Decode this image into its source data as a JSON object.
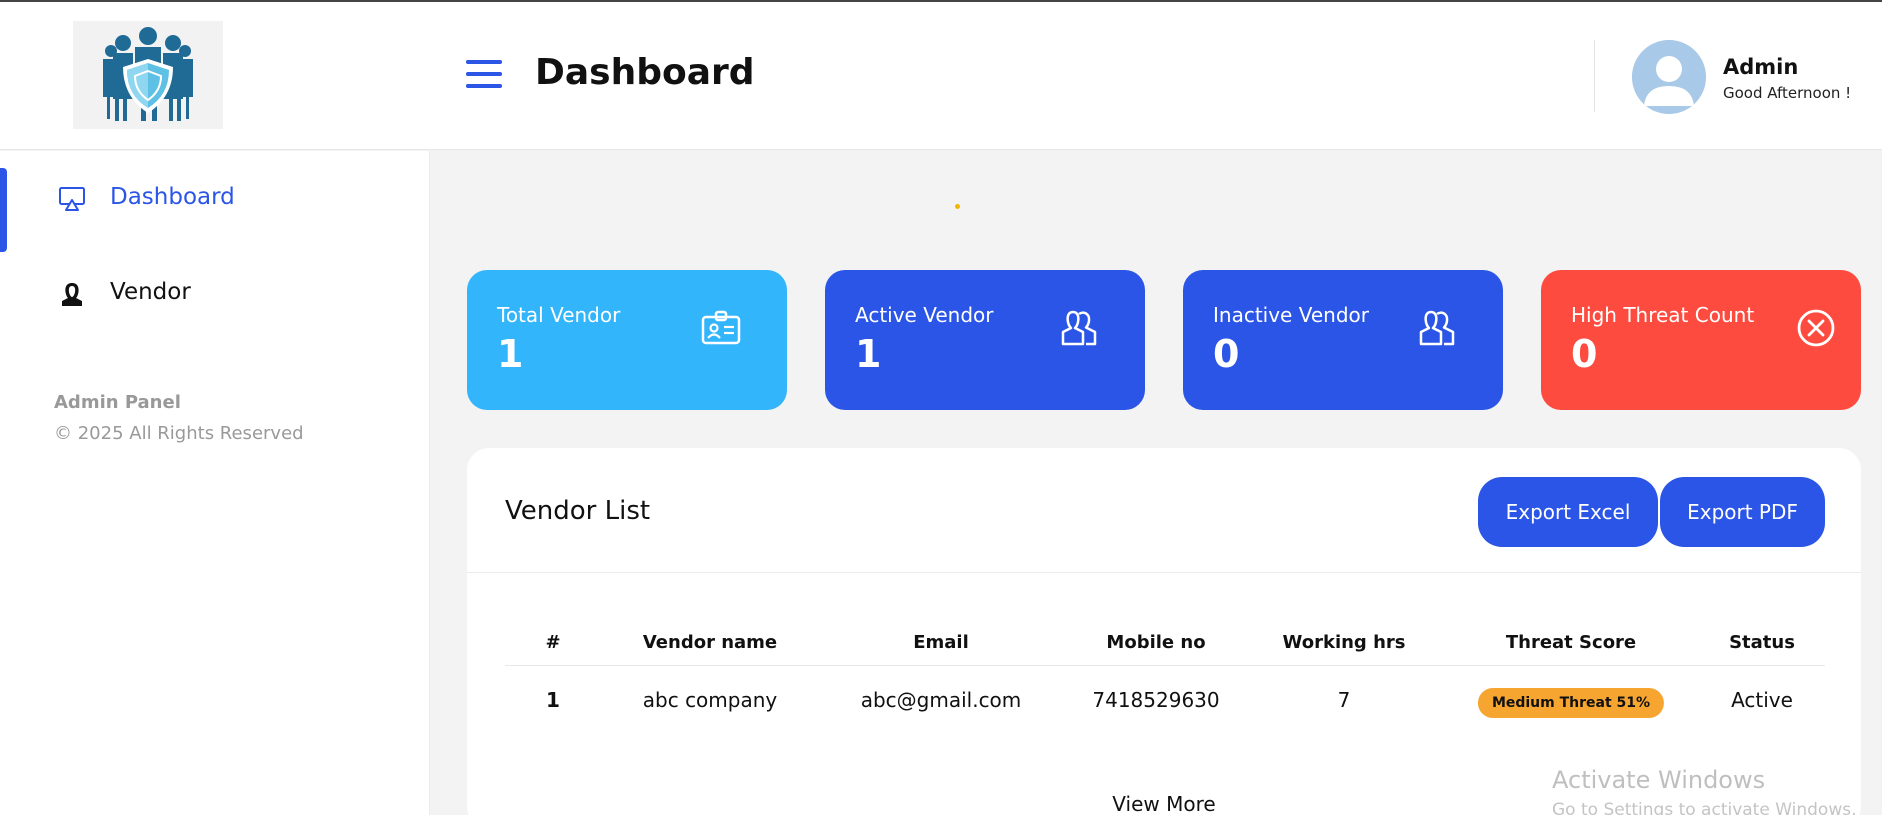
{
  "header": {
    "title": "Dashboard",
    "user_name": "Admin",
    "greeting": "Good Afternoon !",
    "logo_icon": "vendor-shield-logo",
    "menu_icon": "hamburger-icon",
    "avatar_icon": "user-avatar-icon"
  },
  "sidebar": {
    "items": [
      {
        "label": "Dashboard",
        "icon": "monitor-icon",
        "active": true
      },
      {
        "label": "Vendor",
        "icon": "person-icon",
        "active": false
      }
    ],
    "footer_title": "Admin Panel",
    "footer_copy": "© 2025 All Rights Reserved"
  },
  "stats": [
    {
      "label": "Total Vendor",
      "value": "1",
      "icon": "id-card-icon",
      "color": "#32b5fb"
    },
    {
      "label": "Active Vendor",
      "value": "1",
      "icon": "users-icon",
      "color": "#2b55e6"
    },
    {
      "label": "Inactive Vendor",
      "value": "0",
      "icon": "users-icon",
      "color": "#2b55e6"
    },
    {
      "label": "High Threat Count",
      "value": "0",
      "icon": "close-circle-icon",
      "color": "#fe4b3f"
    }
  ],
  "vendor_list": {
    "title": "Vendor List",
    "export_excel": "Export Excel",
    "export_pdf": "Export PDF",
    "columns": [
      "#",
      "Vendor name",
      "Email",
      "Mobile no",
      "Working hrs",
      "Threat Score",
      "Status"
    ],
    "rows": [
      {
        "index": "1",
        "vendor_name": "abc company",
        "email": "abc@gmail.com",
        "mobile": "7418529630",
        "working_hrs": "7",
        "threat_score": "Medium Threat 51%",
        "status": "Active"
      }
    ],
    "view_more": "View More"
  },
  "colors": {
    "accent": "#2b55e6",
    "info": "#32b5fb",
    "danger": "#fe4b3f",
    "warning": "#f7a531"
  },
  "watermark": {
    "line1": "Activate Windows",
    "line2": "Go to Settings to activate Windows."
  }
}
